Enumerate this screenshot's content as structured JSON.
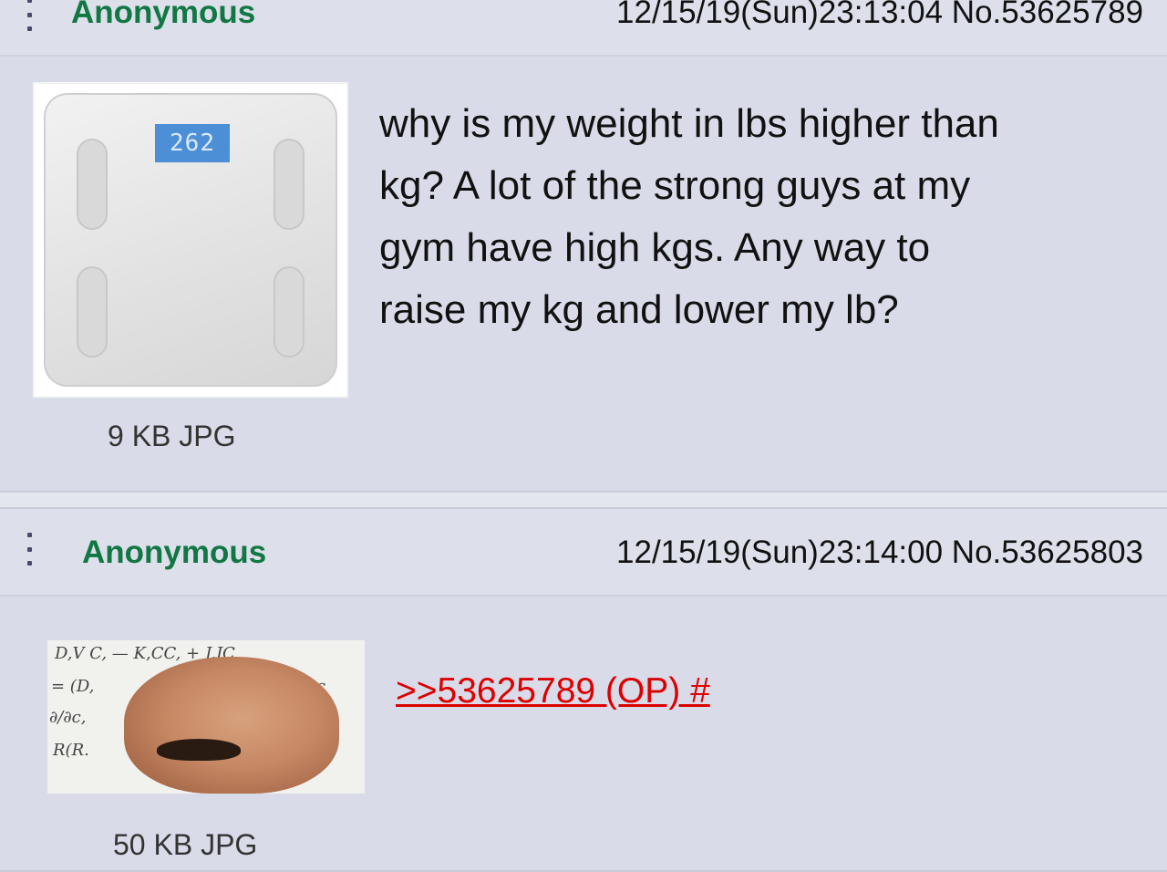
{
  "op": {
    "name": "Anonymous",
    "meta": "12/15/19(Sun)23:13:04 No.53625789",
    "file_size": "9 KB JPG",
    "scale_reading": "262",
    "body_lines": [
      "why is my weight in lbs higher than",
      "kg? A lot of the strong guys at my",
      "gym have high kgs. Any way to",
      "raise my kg and lower my lb?"
    ]
  },
  "reply": {
    "name": "Anonymous",
    "meta": "12/15/19(Sun)23:14:00 No.53625803",
    "file_size": "50 KB JPG",
    "quote_link": ">>53625789 (OP) #"
  },
  "colors": {
    "post_bg": "#d9dce8",
    "name": "#117743",
    "quote_link": "#dd0000"
  },
  "icons": {
    "menu": "post-menu-icon"
  }
}
